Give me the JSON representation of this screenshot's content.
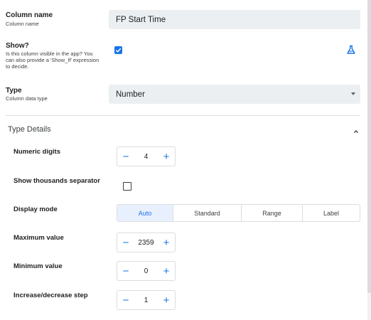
{
  "column_name": {
    "label": "Column name",
    "sublabel": "Column name",
    "value": "FP Start Time"
  },
  "show": {
    "label": "Show?",
    "sublabel": "Is this column visible in the app? You can also provide a 'Show_If' expression to decide.",
    "checked": true
  },
  "type": {
    "label": "Type",
    "sublabel": "Column data type",
    "value": "Number"
  },
  "type_details": {
    "title": "Type Details"
  },
  "numeric_digits": {
    "label": "Numeric digits",
    "value": "4"
  },
  "thousands_separator": {
    "label": "Show thousands separator",
    "checked": false
  },
  "display_mode": {
    "label": "Display mode",
    "options": [
      "Auto",
      "Standard",
      "Range",
      "Label"
    ],
    "selected": "Auto"
  },
  "maximum_value": {
    "label": "Maximum value",
    "value": "2359"
  },
  "minimum_value": {
    "label": "Minimum value",
    "value": "0"
  },
  "step": {
    "label": "Increase/decrease step",
    "value": "1"
  },
  "icons": {
    "test": "flask-icon",
    "collapse": "chevron-up-icon",
    "dropdown": "caret-down-icon",
    "check": "check-icon"
  },
  "colors": {
    "accent": "#1a73e8",
    "field_bg": "#eceff1",
    "segment_active_bg": "#e8f0fe"
  }
}
